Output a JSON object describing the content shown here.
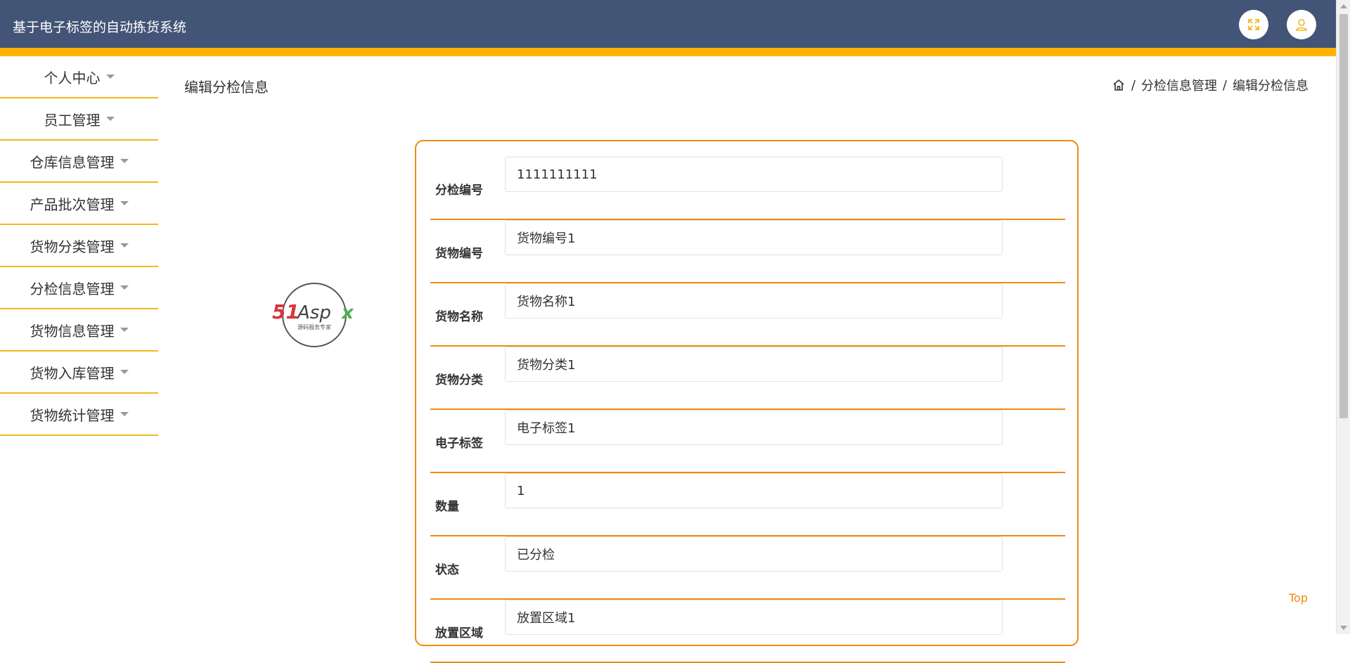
{
  "header": {
    "title": "基于电子标签的自动拣货系统",
    "fullscreen_icon": "expand-icon",
    "user_icon": "user-icon"
  },
  "sidebar": {
    "items": [
      {
        "label": "个人中心"
      },
      {
        "label": "员工管理"
      },
      {
        "label": "仓库信息管理"
      },
      {
        "label": "产品批次管理"
      },
      {
        "label": "货物分类管理"
      },
      {
        "label": "分检信息管理"
      },
      {
        "label": "货物信息管理"
      },
      {
        "label": "货物入库管理"
      },
      {
        "label": "货物统计管理"
      }
    ]
  },
  "page": {
    "title": "编辑分检信息"
  },
  "breadcrumb": {
    "items": [
      "分检信息管理",
      "编辑分检信息"
    ]
  },
  "logo": {
    "text": "51Aspx",
    "subtitle": "源码服务专家"
  },
  "form": {
    "fields": [
      {
        "label": "分检编号",
        "value": "1111111111"
      },
      {
        "label": "货物编号",
        "value": "货物编号1"
      },
      {
        "label": "货物名称",
        "value": "货物名称1"
      },
      {
        "label": "货物分类",
        "value": "货物分类1"
      },
      {
        "label": "电子标签",
        "value": "电子标签1"
      },
      {
        "label": "数量",
        "value": "1"
      },
      {
        "label": "状态",
        "value": "已分检"
      },
      {
        "label": "放置区域",
        "value": "放置区域1"
      }
    ]
  },
  "top_link": "Top",
  "colors": {
    "header_bg": "#425576",
    "accent_bar": "#ffb300",
    "form_border": "#f28a0f",
    "sidebar_divider": "#f3b71f"
  }
}
